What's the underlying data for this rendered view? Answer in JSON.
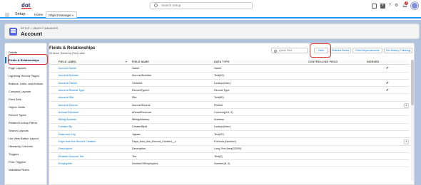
{
  "global_header": {
    "logo_icon": "dot-logo-icon",
    "search_placeholder": "Search Setup",
    "icons": [
      "waffle-icon",
      "favorites-icon",
      "add-icon",
      "help-icon",
      "gear-icon",
      "notifications-icon",
      "avatar"
    ],
    "help_glyph": "?",
    "notification_count": "8"
  },
  "app_nav": {
    "app_name": "Setup",
    "tabs": [
      {
        "label": "Home"
      },
      {
        "label": "Object Manager"
      }
    ]
  },
  "page_header": {
    "breadcrumb": "SETUP > OBJECT MANAGER",
    "title": "Account"
  },
  "sidebar": {
    "items": [
      {
        "label": "Details"
      },
      {
        "label": "Fields & Relationships"
      },
      {
        "label": "Page Layouts"
      },
      {
        "label": "Lightning Record Pages"
      },
      {
        "label": "Buttons, Links, and Actions"
      },
      {
        "label": "Compact Layouts"
      },
      {
        "label": "Field Sets"
      },
      {
        "label": "Object Limits"
      },
      {
        "label": "Record Types"
      },
      {
        "label": "Related Lookup Filters"
      },
      {
        "label": "Search Layouts"
      },
      {
        "label": "List View Button Layout"
      },
      {
        "label": "Hierarchy Columns"
      },
      {
        "label": "Triggers"
      },
      {
        "label": "Flow Triggers"
      },
      {
        "label": "Validation Rules"
      }
    ],
    "active_index": 1
  },
  "main": {
    "title": "Fields & Relationships",
    "subtitle": "25 Items, Sorted by Field Label",
    "quick_find_placeholder": "Quick Find",
    "buttons": {
      "new": "New",
      "deleted_fields": "Deleted Fields",
      "field_dependencies": "Field Dependencies",
      "set_history_tracking": "Set History Tracking"
    },
    "columns": [
      "FIELD LABEL",
      "FIELD NAME",
      "DATA TYPE",
      "CONTROLLING FIELD",
      "INDEXED"
    ],
    "sort_glyph": "▼",
    "check_glyph": "✔",
    "menu_glyph": "▾",
    "rows": [
      {
        "label": "Account Name",
        "name": "Name",
        "type": "Name",
        "controlling": "",
        "indexed": true,
        "menu": false
      },
      {
        "label": "Account Number",
        "name": "AccountNumber",
        "type": "Text(40)",
        "controlling": "",
        "indexed": false,
        "menu": false
      },
      {
        "label": "Account Owner",
        "name": "OwnerId",
        "type": "Lookup(User)",
        "controlling": "",
        "indexed": true,
        "menu": false
      },
      {
        "label": "Account Record Type",
        "name": "RecordTypeId",
        "type": "Record Type",
        "controlling": "",
        "indexed": true,
        "menu": false
      },
      {
        "label": "Account Site",
        "name": "Site",
        "type": "Text(80)",
        "controlling": "",
        "indexed": false,
        "menu": false
      },
      {
        "label": "Account Source",
        "name": "AccountSource",
        "type": "Picklist",
        "controlling": "",
        "indexed": false,
        "menu": true
      },
      {
        "label": "Annual Revenue",
        "name": "AnnualRevenue",
        "type": "Currency(18, 0)",
        "controlling": "",
        "indexed": false,
        "menu": false
      },
      {
        "label": "Billing Address",
        "name": "BillingAddress",
        "type": "Address",
        "controlling": "",
        "indexed": false,
        "menu": false
      },
      {
        "label": "Created By",
        "name": "CreatedById",
        "type": "Lookup(User)",
        "controlling": "",
        "indexed": false,
        "menu": false
      },
      {
        "label": "Data.com Key",
        "name": "Jigsaw",
        "type": "Text(20)",
        "controlling": "",
        "indexed": false,
        "menu": false
      },
      {
        "label": "Days from the Record Created",
        "name": "Days_from_the_Record_Created__c",
        "type": "Formula (Number)",
        "controlling": "",
        "indexed": false,
        "menu": true
      },
      {
        "label": "Description",
        "name": "Description",
        "type": "Long Text Area(32000)",
        "controlling": "",
        "indexed": false,
        "menu": false
      },
      {
        "label": "Einstein Account Tier",
        "name": "Tier",
        "type": "Text(2)",
        "controlling": "",
        "indexed": false,
        "menu": false
      },
      {
        "label": "Employees",
        "name": "NumberOfEmployees",
        "type": "Number(8, 0)",
        "controlling": "",
        "indexed": false,
        "menu": false
      }
    ]
  },
  "colors": {
    "brand_blue": "#0176d3",
    "highlight_red": "#e0312a",
    "background": "#b0c4df",
    "object_icon": "#5867e8"
  }
}
